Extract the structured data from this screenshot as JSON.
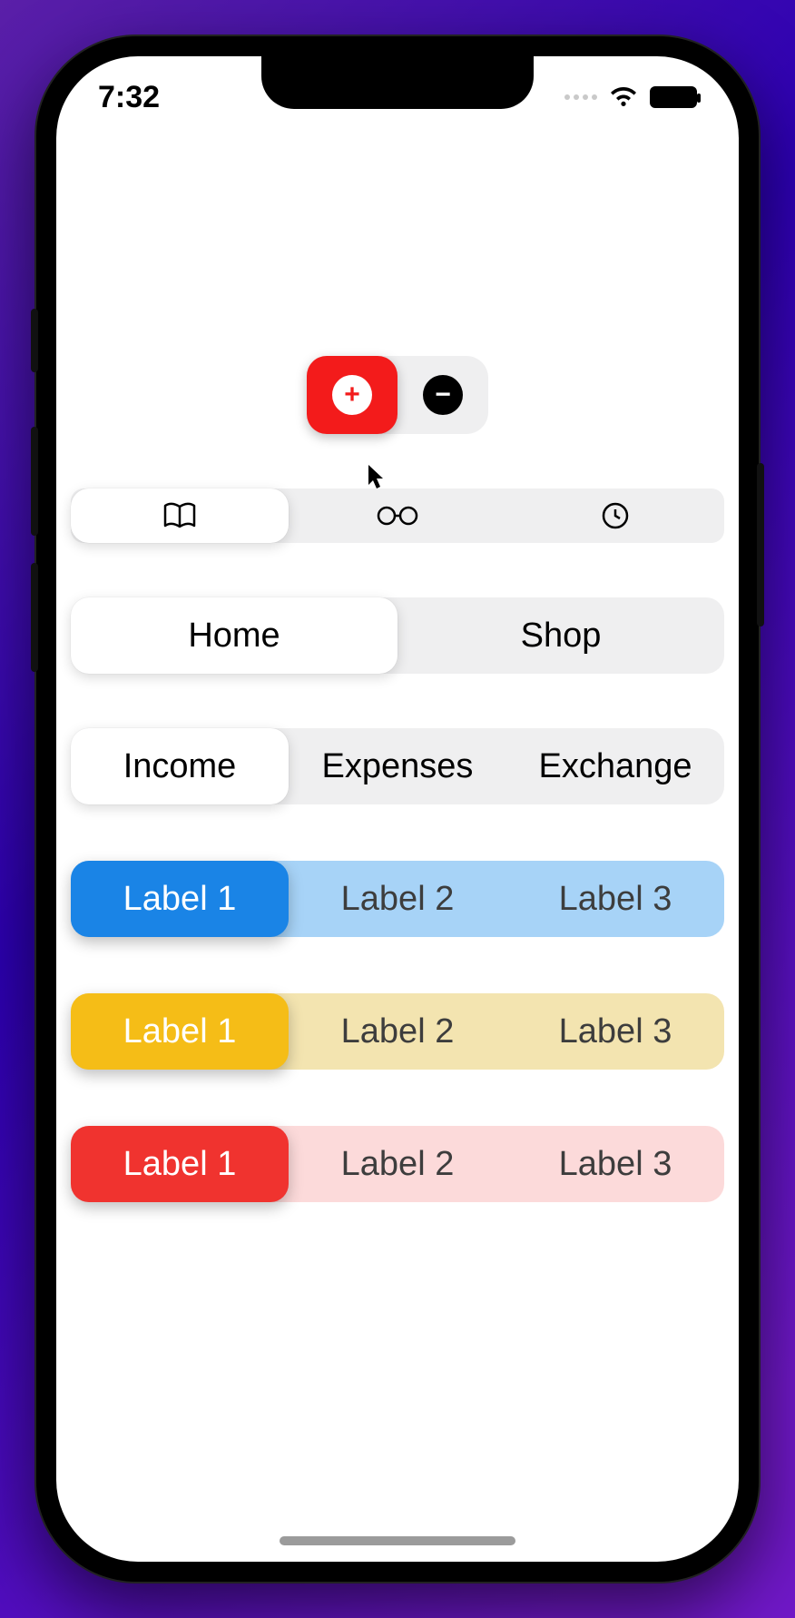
{
  "status": {
    "time": "7:32"
  },
  "toggle": {
    "plus_icon": "plus-icon",
    "minus_icon": "minus-icon",
    "selected": 0
  },
  "icon_tabs": {
    "items": [
      "book-icon",
      "glasses-icon",
      "clock-icon"
    ],
    "selected": 0
  },
  "nav_tabs": {
    "items": [
      {
        "label": "Home"
      },
      {
        "label": "Shop"
      }
    ],
    "selected": 0
  },
  "finance_tabs": {
    "items": [
      {
        "label": "Income"
      },
      {
        "label": "Expenses"
      },
      {
        "label": "Exchange"
      }
    ],
    "selected": 0
  },
  "color_groups": [
    {
      "color": "#1a84e6",
      "bg": "#a7d3f7",
      "items": [
        {
          "label": "Label 1"
        },
        {
          "label": "Label 2"
        },
        {
          "label": "Label 3"
        }
      ],
      "selected": 0
    },
    {
      "color": "#f5bd17",
      "bg": "#f3e4b0",
      "items": [
        {
          "label": "Label 1"
        },
        {
          "label": "Label 2"
        },
        {
          "label": "Label 3"
        }
      ],
      "selected": 0
    },
    {
      "color": "#f0332f",
      "bg": "#fcdada",
      "items": [
        {
          "label": "Label 1"
        },
        {
          "label": "Label 2"
        },
        {
          "label": "Label 3"
        }
      ],
      "selected": 0
    }
  ]
}
